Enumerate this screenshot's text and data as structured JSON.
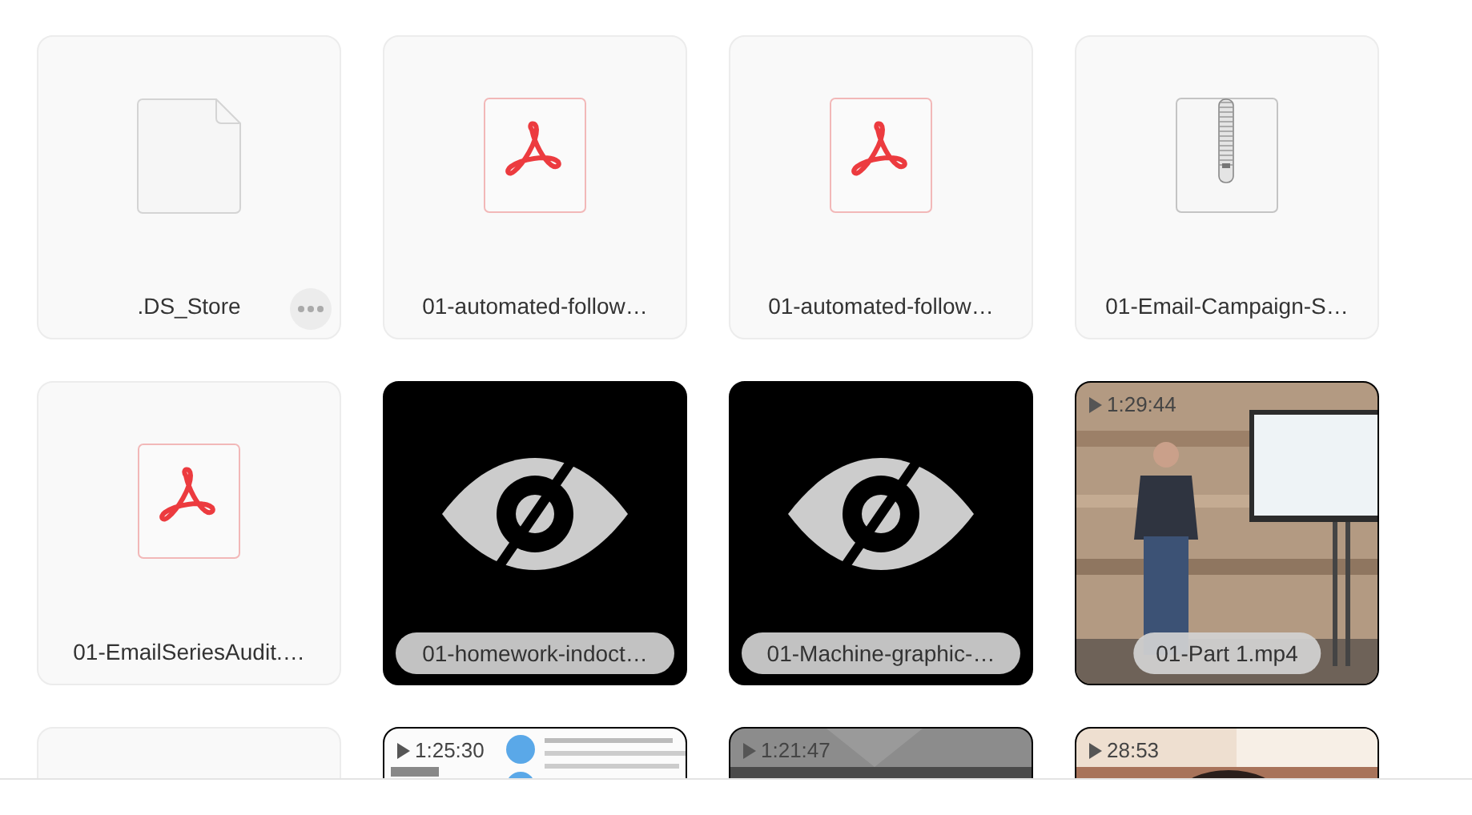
{
  "files": [
    {
      "kind": "file",
      "name": ".DS_Store",
      "menu_button": true
    },
    {
      "kind": "pdf",
      "name": "01-automated-follow…",
      "menu_button": false
    },
    {
      "kind": "pdf",
      "name": "01-automated-follow…",
      "menu_button": false
    },
    {
      "kind": "zip",
      "name": "01-Email-Campaign-S…",
      "menu_button": false
    },
    {
      "kind": "pdf",
      "name": "01-EmailSeriesAudit.…",
      "menu_button": false
    },
    {
      "kind": "hidden",
      "name": "01-homework-indoct…",
      "menu_button": false
    },
    {
      "kind": "hidden",
      "name": "01-Machine-graphic-…",
      "menu_button": false
    },
    {
      "kind": "video",
      "duration": "1:29:44",
      "name": "01-Part 1.mp4",
      "menu_button": false
    },
    {
      "kind": "blank",
      "menu_button": false
    },
    {
      "kind": "video",
      "duration": "1:25:30",
      "menu_button": false
    },
    {
      "kind": "video",
      "duration": "1:21:47",
      "menu_button": false
    },
    {
      "kind": "video",
      "duration": "28:53",
      "menu_button": false
    }
  ]
}
